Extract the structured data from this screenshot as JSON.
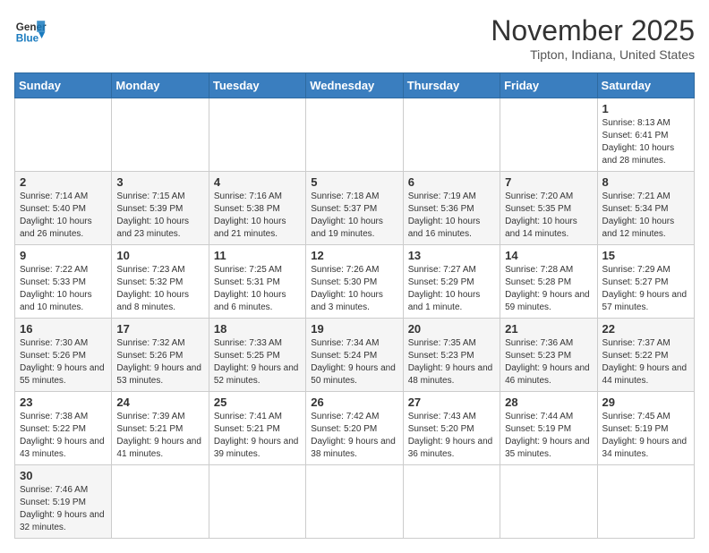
{
  "logo": {
    "text_general": "General",
    "text_blue": "Blue"
  },
  "header": {
    "title": "November 2025",
    "subtitle": "Tipton, Indiana, United States"
  },
  "weekdays": [
    "Sunday",
    "Monday",
    "Tuesday",
    "Wednesday",
    "Thursday",
    "Friday",
    "Saturday"
  ],
  "weeks": [
    [
      {
        "day": "",
        "info": ""
      },
      {
        "day": "",
        "info": ""
      },
      {
        "day": "",
        "info": ""
      },
      {
        "day": "",
        "info": ""
      },
      {
        "day": "",
        "info": ""
      },
      {
        "day": "",
        "info": ""
      },
      {
        "day": "1",
        "info": "Sunrise: 8:13 AM\nSunset: 6:41 PM\nDaylight: 10 hours\nand 28 minutes."
      }
    ],
    [
      {
        "day": "2",
        "info": "Sunrise: 7:14 AM\nSunset: 5:40 PM\nDaylight: 10 hours\nand 26 minutes."
      },
      {
        "day": "3",
        "info": "Sunrise: 7:15 AM\nSunset: 5:39 PM\nDaylight: 10 hours\nand 23 minutes."
      },
      {
        "day": "4",
        "info": "Sunrise: 7:16 AM\nSunset: 5:38 PM\nDaylight: 10 hours\nand 21 minutes."
      },
      {
        "day": "5",
        "info": "Sunrise: 7:18 AM\nSunset: 5:37 PM\nDaylight: 10 hours\nand 19 minutes."
      },
      {
        "day": "6",
        "info": "Sunrise: 7:19 AM\nSunset: 5:36 PM\nDaylight: 10 hours\nand 16 minutes."
      },
      {
        "day": "7",
        "info": "Sunrise: 7:20 AM\nSunset: 5:35 PM\nDaylight: 10 hours\nand 14 minutes."
      },
      {
        "day": "8",
        "info": "Sunrise: 7:21 AM\nSunset: 5:34 PM\nDaylight: 10 hours\nand 12 minutes."
      }
    ],
    [
      {
        "day": "9",
        "info": "Sunrise: 7:22 AM\nSunset: 5:33 PM\nDaylight: 10 hours\nand 10 minutes."
      },
      {
        "day": "10",
        "info": "Sunrise: 7:23 AM\nSunset: 5:32 PM\nDaylight: 10 hours\nand 8 minutes."
      },
      {
        "day": "11",
        "info": "Sunrise: 7:25 AM\nSunset: 5:31 PM\nDaylight: 10 hours\nand 6 minutes."
      },
      {
        "day": "12",
        "info": "Sunrise: 7:26 AM\nSunset: 5:30 PM\nDaylight: 10 hours\nand 3 minutes."
      },
      {
        "day": "13",
        "info": "Sunrise: 7:27 AM\nSunset: 5:29 PM\nDaylight: 10 hours\nand 1 minute."
      },
      {
        "day": "14",
        "info": "Sunrise: 7:28 AM\nSunset: 5:28 PM\nDaylight: 9 hours\nand 59 minutes."
      },
      {
        "day": "15",
        "info": "Sunrise: 7:29 AM\nSunset: 5:27 PM\nDaylight: 9 hours\nand 57 minutes."
      }
    ],
    [
      {
        "day": "16",
        "info": "Sunrise: 7:30 AM\nSunset: 5:26 PM\nDaylight: 9 hours\nand 55 minutes."
      },
      {
        "day": "17",
        "info": "Sunrise: 7:32 AM\nSunset: 5:26 PM\nDaylight: 9 hours\nand 53 minutes."
      },
      {
        "day": "18",
        "info": "Sunrise: 7:33 AM\nSunset: 5:25 PM\nDaylight: 9 hours\nand 52 minutes."
      },
      {
        "day": "19",
        "info": "Sunrise: 7:34 AM\nSunset: 5:24 PM\nDaylight: 9 hours\nand 50 minutes."
      },
      {
        "day": "20",
        "info": "Sunrise: 7:35 AM\nSunset: 5:23 PM\nDaylight: 9 hours\nand 48 minutes."
      },
      {
        "day": "21",
        "info": "Sunrise: 7:36 AM\nSunset: 5:23 PM\nDaylight: 9 hours\nand 46 minutes."
      },
      {
        "day": "22",
        "info": "Sunrise: 7:37 AM\nSunset: 5:22 PM\nDaylight: 9 hours\nand 44 minutes."
      }
    ],
    [
      {
        "day": "23",
        "info": "Sunrise: 7:38 AM\nSunset: 5:22 PM\nDaylight: 9 hours\nand 43 minutes."
      },
      {
        "day": "24",
        "info": "Sunrise: 7:39 AM\nSunset: 5:21 PM\nDaylight: 9 hours\nand 41 minutes."
      },
      {
        "day": "25",
        "info": "Sunrise: 7:41 AM\nSunset: 5:21 PM\nDaylight: 9 hours\nand 39 minutes."
      },
      {
        "day": "26",
        "info": "Sunrise: 7:42 AM\nSunset: 5:20 PM\nDaylight: 9 hours\nand 38 minutes."
      },
      {
        "day": "27",
        "info": "Sunrise: 7:43 AM\nSunset: 5:20 PM\nDaylight: 9 hours\nand 36 minutes."
      },
      {
        "day": "28",
        "info": "Sunrise: 7:44 AM\nSunset: 5:19 PM\nDaylight: 9 hours\nand 35 minutes."
      },
      {
        "day": "29",
        "info": "Sunrise: 7:45 AM\nSunset: 5:19 PM\nDaylight: 9 hours\nand 34 minutes."
      }
    ],
    [
      {
        "day": "30",
        "info": "Sunrise: 7:46 AM\nSunset: 5:19 PM\nDaylight: 9 hours\nand 32 minutes."
      },
      {
        "day": "",
        "info": ""
      },
      {
        "day": "",
        "info": ""
      },
      {
        "day": "",
        "info": ""
      },
      {
        "day": "",
        "info": ""
      },
      {
        "day": "",
        "info": ""
      },
      {
        "day": "",
        "info": ""
      }
    ]
  ]
}
